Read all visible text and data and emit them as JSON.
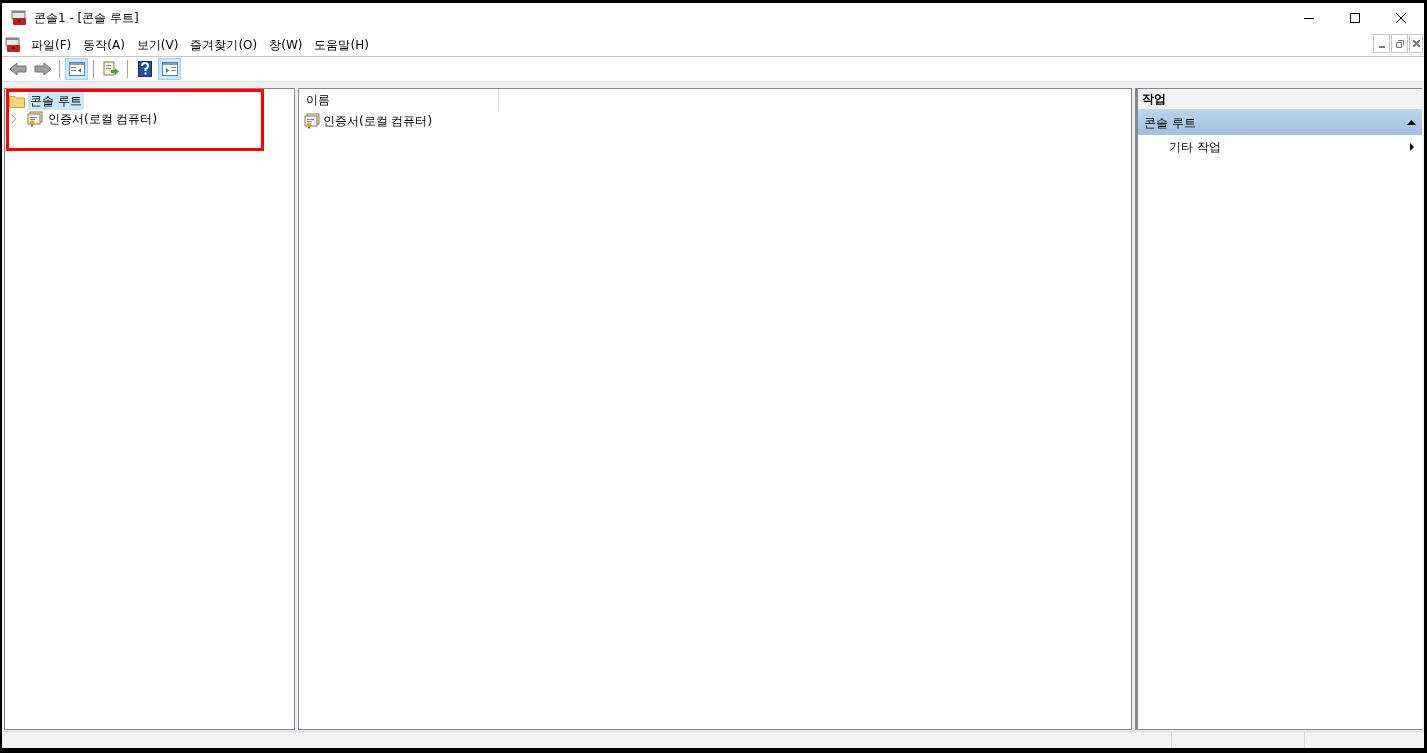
{
  "window": {
    "title": "콘솔1 - [콘솔 루트]"
  },
  "menu": [
    "파일(F)",
    "동작(A)",
    "보기(V)",
    "즐겨찾기(O)",
    "창(W)",
    "도움말(H)"
  ],
  "toolbar": [
    {
      "kind": "back",
      "selected": false
    },
    {
      "kind": "forward",
      "selected": false
    },
    {
      "kind": "sep"
    },
    {
      "kind": "tree",
      "selected": true
    },
    {
      "kind": "sep"
    },
    {
      "kind": "export",
      "selected": false
    },
    {
      "kind": "sep"
    },
    {
      "kind": "help",
      "selected": false
    },
    {
      "kind": "actionpane",
      "selected": true
    }
  ],
  "tree": {
    "label": "콘솔 루트",
    "selected": true,
    "children": [
      {
        "label": "인증서(로컬 컴퓨터)",
        "selected": false,
        "expanded": false
      }
    ]
  },
  "list": {
    "columns": [
      "이름"
    ],
    "rows": [
      "인증서(로컬 컴퓨터)"
    ]
  },
  "actions": {
    "title": "작업",
    "sections": [
      {
        "title": "콘솔 루트",
        "expanded": true,
        "items": [
          "기타 작업"
        ]
      }
    ]
  }
}
